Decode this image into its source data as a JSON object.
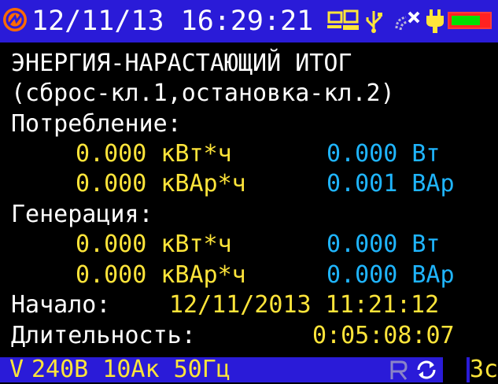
{
  "status_bar": {
    "datetime": "12/11/13 16:29:21",
    "icons": [
      "device-logo-icon",
      "pc-link-icon",
      "usb-icon",
      "wireless-off-icon",
      "power-plug-icon",
      "battery-icon"
    ]
  },
  "title": "ЭНЕРГИЯ-НАРАСТАЮЩИЙ ИТОГ",
  "hint": "(сброс-кл.1,остановка-кл.2)",
  "consumption": {
    "label": "Потребление:",
    "active_energy": "0.000 кВт*ч",
    "active_power": "0.000 Вт",
    "reactive_energy": "0.000 кВАр*ч",
    "reactive_power": "0.001 ВАр"
  },
  "generation": {
    "label": "Генерация:",
    "active_energy": "0.000 кВт*ч",
    "active_power": "0.000 Вт",
    "reactive_energy": "0.000 кВАр*ч",
    "reactive_power": "0.000 ВАр"
  },
  "start": {
    "label": "Начало:",
    "value": "12/11/2013 11:21:12"
  },
  "duration": {
    "label": "Длительность:",
    "value": "0:05:08:07"
  },
  "bottom_bar": {
    "voltage_icon": "V",
    "params": "240В 10Ак 50Гц",
    "page": "3с"
  },
  "colors": {
    "bar_bg": "#2a1bd8",
    "accent_yellow": "#ffe53a",
    "accent_cyan": "#1fb5ff",
    "text_white": "#ffffff",
    "battery_red": "#ff2222",
    "battery_green": "#00e000",
    "logo_orange": "#ff6a00"
  }
}
